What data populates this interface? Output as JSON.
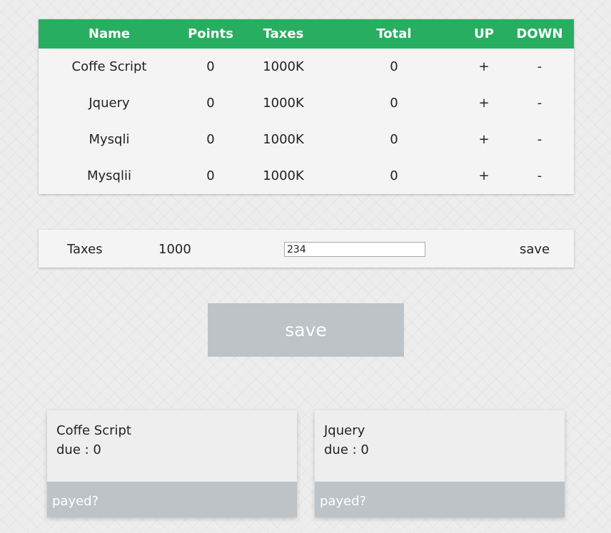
{
  "table": {
    "headers": {
      "name": "Name",
      "points": "Points",
      "taxes": "Taxes",
      "total": "Total",
      "up": "UP",
      "down": "DOWN"
    },
    "rows": [
      {
        "name": "Coffe Script",
        "points": "0",
        "taxes": "1000K",
        "total": "0",
        "up": "+",
        "down": "-"
      },
      {
        "name": "Jquery",
        "points": "0",
        "taxes": "1000K",
        "total": "0",
        "up": "+",
        "down": "-"
      },
      {
        "name": "Mysqli",
        "points": "0",
        "taxes": "1000K",
        "total": "0",
        "up": "+",
        "down": "-"
      },
      {
        "name": "Mysqlii",
        "points": "0",
        "taxes": "1000K",
        "total": "0",
        "up": "+",
        "down": "-"
      }
    ]
  },
  "taxes_bar": {
    "label": "Taxes",
    "value": "1000",
    "input_value": "234",
    "save_label": "save"
  },
  "save_button": {
    "label": "save"
  },
  "cards": [
    {
      "name": "Coffe Script",
      "due": "due : 0",
      "footer": "payed?"
    },
    {
      "name": "Jquery",
      "due": "due : 0",
      "footer": "payed?"
    }
  ],
  "colors": {
    "header_green": "#27ae60",
    "button_gray": "#bdc3c7",
    "panel_bg": "#f4f4f4"
  }
}
